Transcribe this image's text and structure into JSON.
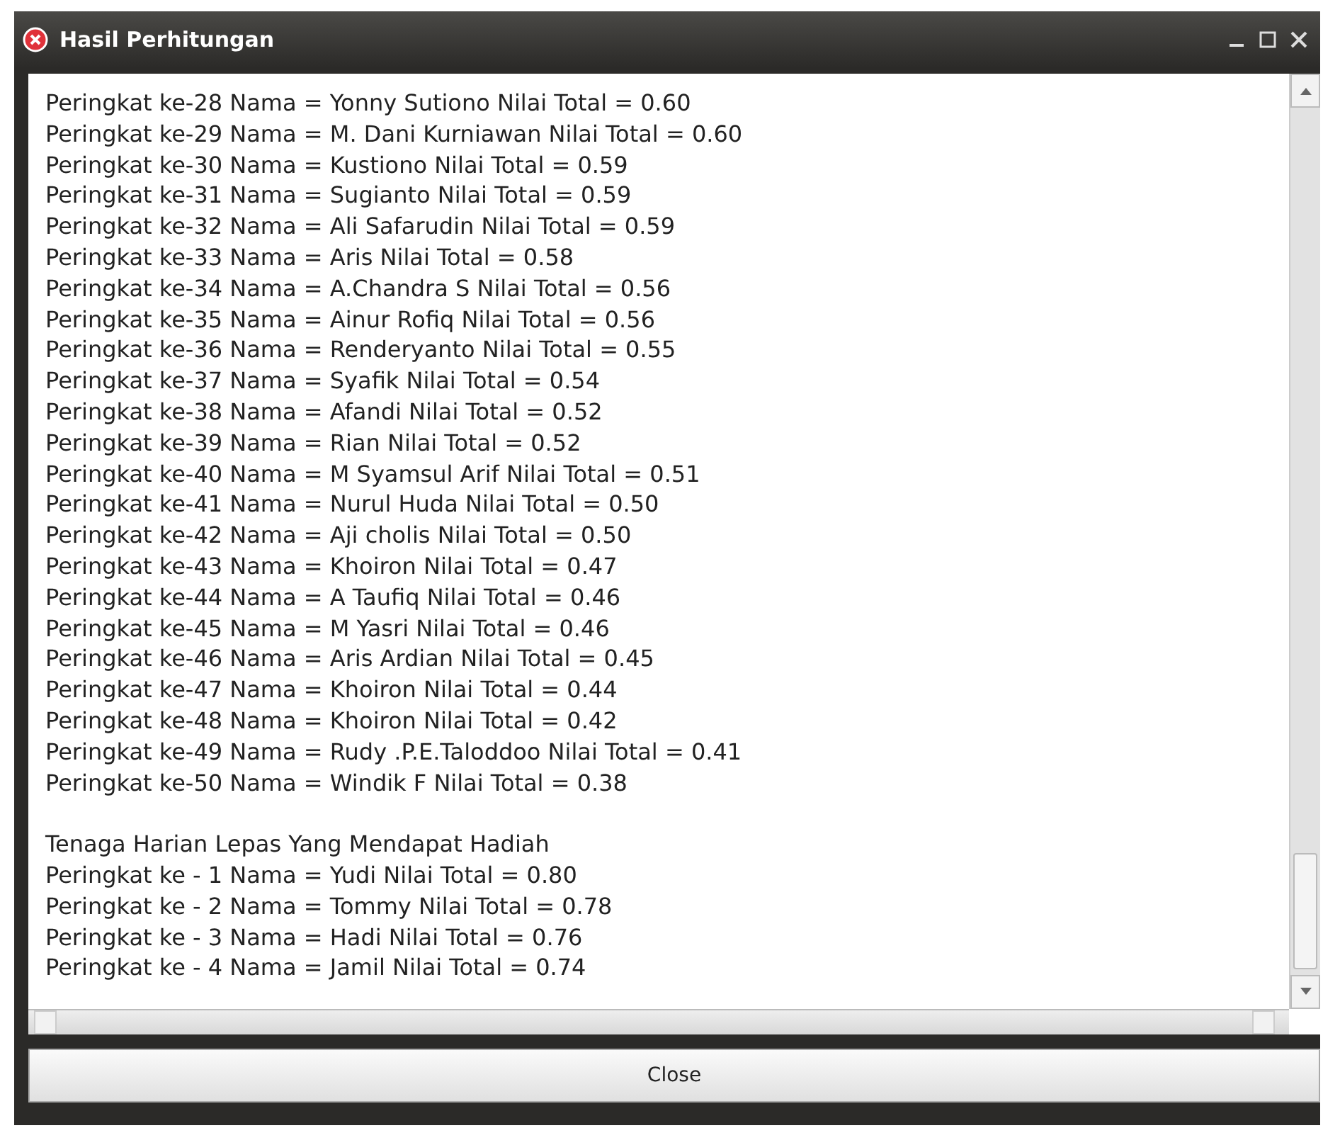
{
  "window": {
    "title": "Hasil Perhitungan"
  },
  "sections": [
    {
      "lines": [
        "Peringkat ke-28 Nama = Yonny Sutiono Nilai Total = 0.60",
        "Peringkat ke-29 Nama = M. Dani Kurniawan Nilai Total = 0.60",
        "Peringkat ke-30 Nama = Kustiono Nilai Total = 0.59",
        "Peringkat ke-31 Nama = Sugianto Nilai Total = 0.59",
        "Peringkat ke-32 Nama = Ali Safarudin Nilai Total = 0.59",
        "Peringkat ke-33 Nama = Aris Nilai Total = 0.58",
        "Peringkat ke-34 Nama = A.Chandra S Nilai Total = 0.56",
        "Peringkat ke-35 Nama = Ainur Rofiq Nilai Total = 0.56",
        "Peringkat ke-36 Nama = Renderyanto Nilai Total = 0.55",
        "Peringkat ke-37 Nama = Syafik Nilai Total = 0.54",
        "Peringkat ke-38 Nama = Afandi Nilai Total = 0.52",
        "Peringkat ke-39 Nama = Rian Nilai Total = 0.52",
        "Peringkat ke-40 Nama = M Syamsul Arif Nilai Total = 0.51",
        "Peringkat ke-41 Nama = Nurul Huda Nilai Total = 0.50",
        "Peringkat ke-42 Nama = Aji cholis Nilai Total = 0.50",
        "Peringkat ke-43 Nama = Khoiron Nilai Total = 0.47",
        "Peringkat ke-44 Nama = A Taufiq Nilai Total = 0.46",
        "Peringkat ke-45 Nama = M Yasri Nilai Total = 0.46",
        "Peringkat ke-46 Nama = Aris Ardian Nilai Total = 0.45",
        "Peringkat ke-47 Nama = Khoiron Nilai Total = 0.44",
        "Peringkat ke-48 Nama = Khoiron Nilai Total = 0.42",
        "Peringkat ke-49 Nama = Rudy .P.E.Taloddoo Nilai Total = 0.41",
        "Peringkat ke-50 Nama = Windik F Nilai Total = 0.38"
      ]
    },
    {
      "heading": "Tenaga Harian Lepas Yang Mendapat Hadiah",
      "lines": [
        "Peringkat ke - 1 Nama = Yudi Nilai Total = 0.80",
        "Peringkat ke - 2 Nama = Tommy Nilai Total = 0.78",
        "Peringkat ke - 3 Nama = Hadi Nilai Total = 0.76",
        "Peringkat ke - 4 Nama = Jamil Nilai Total = 0.74"
      ]
    }
  ],
  "buttons": [
    "Close"
  ]
}
